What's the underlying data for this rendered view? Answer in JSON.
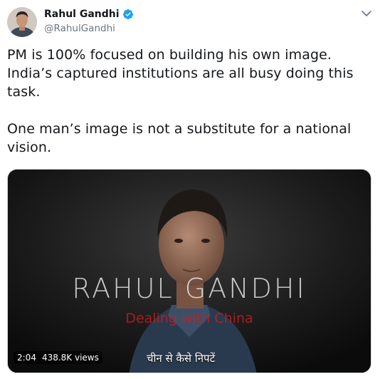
{
  "header": {
    "display_name": "Rahul Gandhi",
    "handle": "@RahulGandhi",
    "verified": true,
    "menu_icon": "chevron-down-icon",
    "accent_color": "#1da1f2"
  },
  "tweet": {
    "text": "PM is 100% focused on building his own image.\nIndia’s captured institutions are all busy doing this task.\n\nOne man’s image is not a substitute for a national vision."
  },
  "media": {
    "type": "video",
    "overlay_title": "RAHUL GANDHI",
    "overlay_subtitle": "Dealing with China",
    "caption": "चीन से कैसे निपटें",
    "duration": "2:04",
    "views": "438.8K views"
  }
}
